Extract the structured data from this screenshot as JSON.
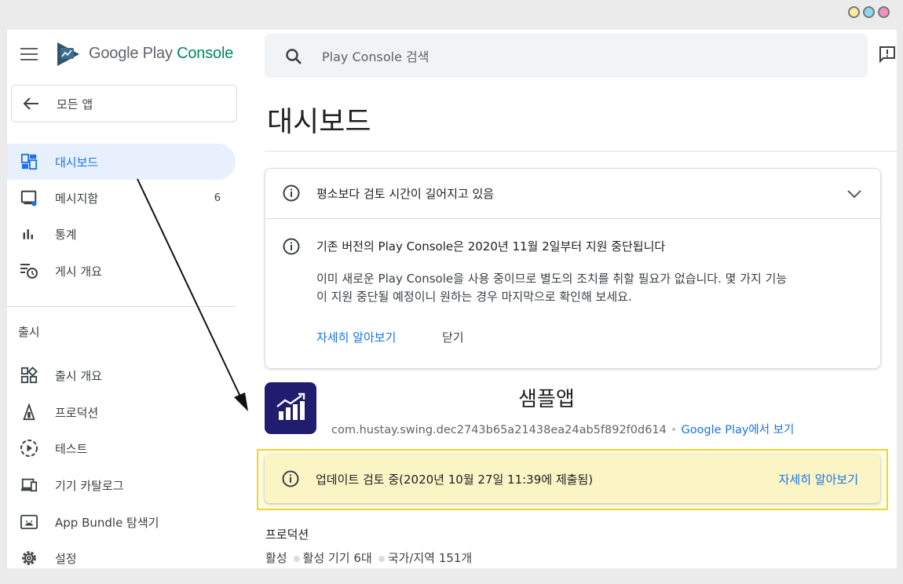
{
  "window": {
    "traffic_lights": [
      "#f7ef9a",
      "#8ed6f0",
      "#f08fc0"
    ]
  },
  "header": {
    "logo_text_prefix": "Google Play ",
    "logo_text_accent": "Console",
    "search_placeholder": "Play Console 검색"
  },
  "sidebar": {
    "back_label": "모든 앱",
    "items": [
      {
        "label": "대시보드",
        "icon": "dashboard-icon",
        "active": true
      },
      {
        "label": "메시지함",
        "icon": "inbox-icon",
        "count": "6"
      },
      {
        "label": "통계",
        "icon": "bar-chart-icon"
      },
      {
        "label": "게시 개요",
        "icon": "publishing-overview-icon"
      }
    ],
    "section_title": "출시",
    "release_items": [
      {
        "label": "출시 개요",
        "icon": "release-overview-icon"
      },
      {
        "label": "프로덕션",
        "icon": "production-icon"
      },
      {
        "label": "테스트",
        "icon": "testing-icon"
      },
      {
        "label": "기기 카탈로그",
        "icon": "device-catalog-icon"
      },
      {
        "label": "App Bundle 탐색기",
        "icon": "android-icon"
      },
      {
        "label": "설정",
        "icon": "settings-gear-icon"
      }
    ]
  },
  "main": {
    "page_title": "대시보드",
    "notice": {
      "header": "평소보다 검토 시간이 길어지고 있음",
      "title": "기존 버전의 Play Console은 2020년 11월 2일부터 지원 중단됩니다",
      "body_line1": "이미 새로운 Play Console을 사용 중이므로 별도의 조치를 취할 필요가 없습니다. 몇 가지 기능",
      "body_line2": "이 지원 중단될 예정이니 원하는 경우 마지막으로 확인해 보세요.",
      "learn_more": "자세히 알아보기",
      "dismiss": "닫기"
    },
    "app": {
      "name": "샘플앱",
      "package": "com.hustay.swing.dec2743b65a21438ea24ab5f892f0d614",
      "view_on_play": "Google Play에서 보기"
    },
    "update_card": {
      "text": "업데이트 검토 중(2020년 10월 27일 11:39에 제출됨)",
      "learn_more": "자세히 알아보기"
    },
    "production": {
      "title": "프로덕션",
      "status": "활성",
      "devices": "활성 기기 6대",
      "countries": "국가/지역 151개"
    }
  },
  "colors": {
    "accent": "#1a73e8",
    "app_icon_bg": "#201d6e",
    "highlight_border": "#f0d530"
  }
}
